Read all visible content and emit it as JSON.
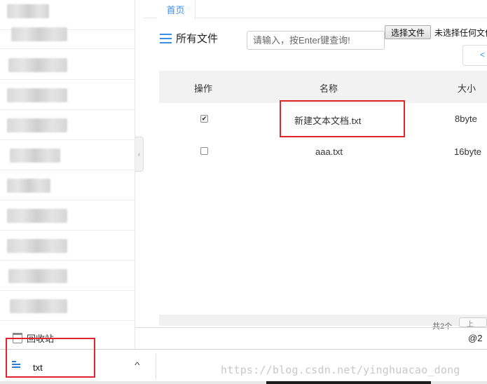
{
  "tabs": {
    "home": "首页"
  },
  "toolbar": {
    "section_title": "所有文件",
    "search_placeholder": "请输入，按Enter键查询!",
    "choose_file": "选择文件",
    "no_file": "未选择任何文件",
    "mini_btn": "<"
  },
  "table": {
    "headers": {
      "action": "操作",
      "name": "名称",
      "size": "大小"
    },
    "rows": [
      {
        "checked": true,
        "check_mark": "✔",
        "name": "新建文本文档.txt",
        "size": "8byte"
      },
      {
        "checked": false,
        "check_mark": "",
        "name": "aaa.txt",
        "size": "16byte"
      }
    ],
    "count": "共2个",
    "pager": "上"
  },
  "sidebar": {
    "recycle_label": "回收站",
    "collapse_glyph": "‹"
  },
  "footer_text": "@2",
  "download": {
    "file_name": "txt",
    "chevron": "^"
  },
  "watermark": "https://blog.csdn.net/yinghuacao_dong",
  "colors": {
    "accent": "#3a8ee6",
    "annotation": "#e0262c"
  }
}
